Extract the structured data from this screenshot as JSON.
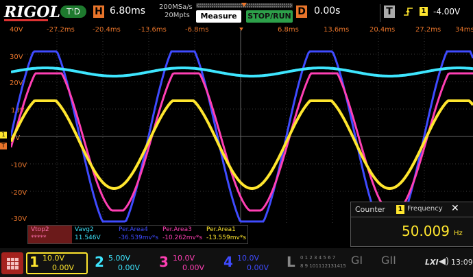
{
  "brand": "RIGOL",
  "trigger_status": "T'D",
  "horizontal": {
    "label": "H",
    "scale": "6.80ms",
    "sample_rate": "200MSa/s",
    "memory": "20Mpts"
  },
  "buttons": {
    "measure": "Measure",
    "stop_run": "STOP/RUN"
  },
  "delay": {
    "label": "D",
    "value": "0.00s"
  },
  "trigger": {
    "label": "T",
    "source": "1",
    "level": "-4.00V"
  },
  "x_ticks": [
    "-27.2ms",
    "-20.4ms",
    "-13.6ms",
    "-6.8ms",
    "6.8ms",
    "13.6ms",
    "20.4ms",
    "27.2ms",
    "34ms"
  ],
  "y_ticks": [
    "40V",
    "30V",
    "20V",
    "10V",
    "0V",
    "-10V",
    "-20V",
    "-30V"
  ],
  "measurements": [
    {
      "name": "Vtop2",
      "value": "*****",
      "color": "#ff6fb0",
      "bg": "#6b1a1a"
    },
    {
      "name": "Vavg2",
      "value": "11.546V",
      "color": "#3ee6ff",
      "bg": "#000000"
    },
    {
      "name": "Per.Area4",
      "value": "-36.539mv*s",
      "color": "#3f4bff",
      "bg": "#000000"
    },
    {
      "name": "Per.Area3",
      "value": "-10.262mv*s",
      "color": "#ff3fb4",
      "bg": "#000000"
    },
    {
      "name": "Per.Area1",
      "value": "-13.559mv*s",
      "color": "#ffe62e",
      "bg": "#000000"
    }
  ],
  "counter": {
    "title": "Counter",
    "source": "1",
    "mode": "Frequency",
    "value": "50.009",
    "unit": "Hz"
  },
  "channels": [
    {
      "num": "1",
      "scale": "10.0V",
      "offset": "0.00V",
      "color": "#ffe62e",
      "active": true
    },
    {
      "num": "2",
      "scale": "5.00V",
      "offset": "0.00V",
      "color": "#3ee6ff",
      "active": false
    },
    {
      "num": "3",
      "scale": "10.0V",
      "offset": "0.00V",
      "color": "#ff3fb4",
      "active": false
    },
    {
      "num": "4",
      "scale": "10.0V",
      "offset": "0.00V",
      "color": "#3f4bff",
      "active": false
    }
  ],
  "logic": {
    "label": "L",
    "row1": "0 1 2 3 4 5 6 7",
    "row2": "8 9 101112131415"
  },
  "generators": [
    "GI",
    "GII"
  ],
  "lxi": "LXI",
  "clock": "13:09",
  "colors": {
    "ch1": "#ffe62e",
    "ch2": "#3ee6ff",
    "ch3": "#ff3fb4",
    "ch4": "#3f4bff",
    "accent": "#e8742a"
  },
  "icons": {
    "menu": "grid-menu-icon",
    "speaker": "speaker-icon",
    "trigger_edge": "rising-edge-icon"
  }
}
